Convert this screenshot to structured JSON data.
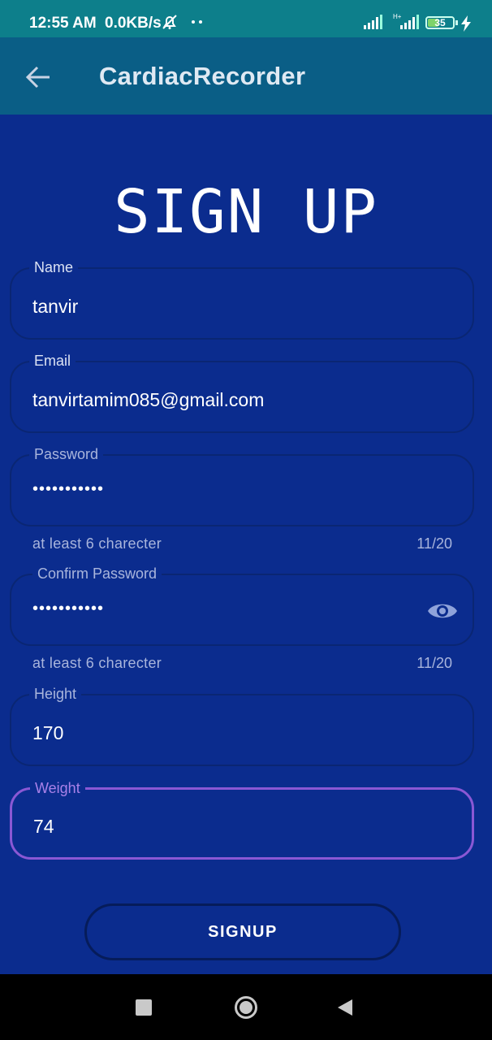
{
  "status_bar": {
    "time": "12:55 AM",
    "speed": "0.0KB/s",
    "battery": "35",
    "icons": [
      "alarm-off-icon",
      "more-dots-icon",
      "signal-icon",
      "signal-hplus-icon",
      "battery-icon",
      "charging-icon"
    ]
  },
  "app_bar": {
    "title": "CardiacRecorder",
    "back_icon": "arrow-left-icon"
  },
  "heading": "SIGN UP",
  "form": {
    "name": {
      "label": "Name",
      "value": "tanvir"
    },
    "email": {
      "label": "Email",
      "value": "tanvirtamim085@gmail.com"
    },
    "password": {
      "label": "Password",
      "value": "•••••••••••",
      "helper": "at least 6 charecter",
      "counter": "11/20"
    },
    "confirm_password": {
      "label": "Confirm Password",
      "value": "•••••••••••",
      "helper": "at least 6 charecter",
      "counter": "11/20",
      "toggle_icon": "eye-icon"
    },
    "height": {
      "label": "Height",
      "value": "170"
    },
    "weight": {
      "label": "Weight",
      "value": "74"
    }
  },
  "signup_button": "SIGNUP",
  "colors": {
    "background": "#0b2c8e",
    "status_bar": "#0d7f8b",
    "app_bar": "#0a5e86",
    "focus_outline": "#8a58d4"
  },
  "nav_bar": {
    "icons": [
      "recents-square-icon",
      "home-circle-icon",
      "back-triangle-icon"
    ]
  }
}
